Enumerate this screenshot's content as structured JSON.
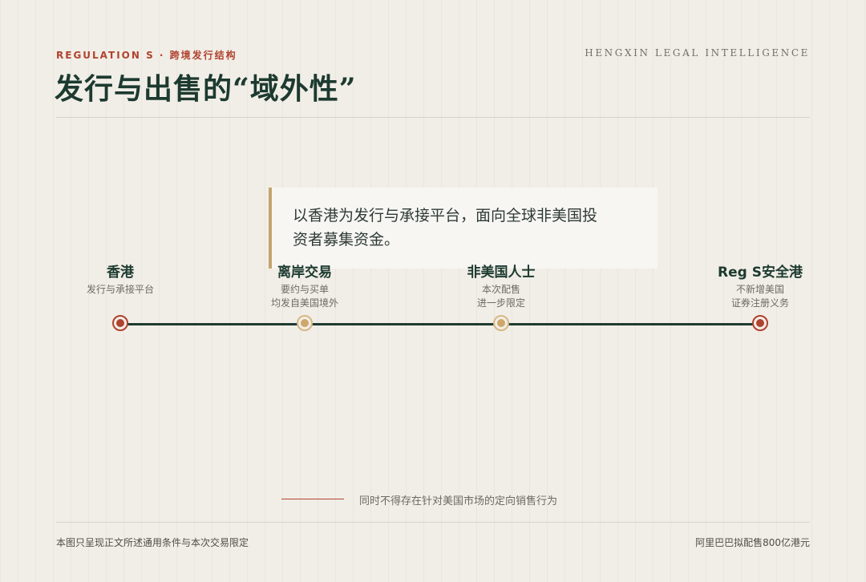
{
  "header": {
    "kicker": "REGULATION S · 跨境发行结构",
    "brand": "HENGXIN LEGAL INTELLIGENCE",
    "title": "发行与出售的“域外性”"
  },
  "quote": {
    "line1": "以香港为发行与承接平台，面向全球非美国投",
    "line2": "资者募集资金。"
  },
  "timeline": {
    "nodes": [
      {
        "title": "香港",
        "desc": [
          "发行与承接平台"
        ],
        "marker": "red"
      },
      {
        "title": "离岸交易",
        "desc": [
          "要约与买单",
          "均发自美国境外"
        ],
        "marker": "gold"
      },
      {
        "title": "非美国人士",
        "desc": [
          "本次配售",
          "进一步限定"
        ],
        "marker": "gold"
      },
      {
        "title": "Reg S安全港",
        "desc": [
          "不新增美国",
          "证券注册义务"
        ],
        "marker": "red"
      }
    ]
  },
  "note": "同时不得存在针对美国市场的定向销售行为",
  "footer": {
    "left": "本图只呈现正文所述通用条件与本次交易限定",
    "right": "阿里巴巴拟配售800亿港元"
  },
  "colors": {
    "accent_red": "#b0432f",
    "accent_gold": "#cfa76a",
    "primary_green": "#1c3a30",
    "background": "#f1eee7"
  }
}
